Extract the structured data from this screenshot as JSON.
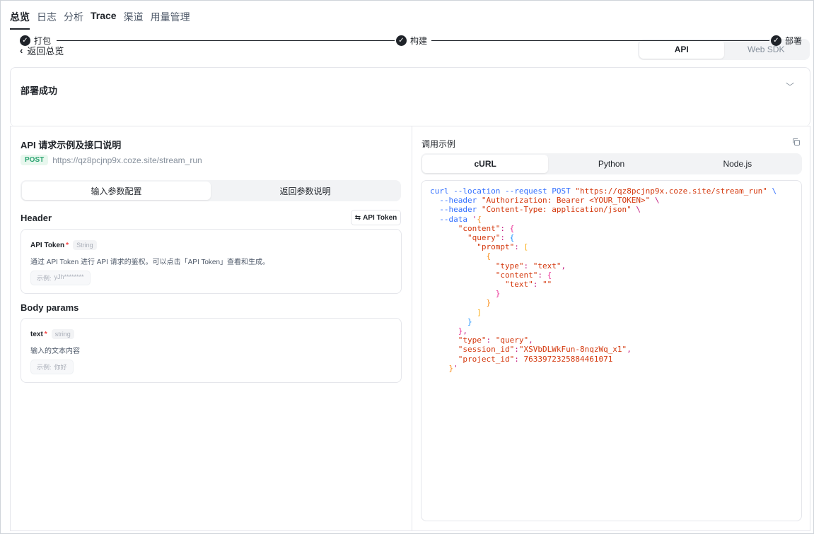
{
  "nav": {
    "tabs": [
      {
        "label": "总览"
      },
      {
        "label": "日志"
      },
      {
        "label": "分析"
      },
      {
        "label": "Trace"
      },
      {
        "label": "渠道"
      },
      {
        "label": "用量管理"
      }
    ]
  },
  "back_label": "返回总览",
  "mode_switch": {
    "api": "API",
    "web_sdk": "Web SDK"
  },
  "deploy": {
    "title": "部署成功",
    "steps": [
      {
        "label": "打包"
      },
      {
        "label": "构建"
      },
      {
        "label": "部署"
      }
    ]
  },
  "api": {
    "title": "API 请求示例及接口说明",
    "method": "POST",
    "url": "https://qz8pcjnp9x.coze.site/stream_run",
    "tabs": {
      "input": "输入参数配置",
      "output": "返回参数说明"
    },
    "header_section": "Header",
    "token_button": "API Token",
    "header_params": [
      {
        "name": "API Token",
        "type": "String",
        "desc": "通过 API Token 进行 API 请求的鉴权。可以点击「API Token」查看和生成。",
        "example_label": "示例:",
        "example": "yJh********"
      }
    ],
    "body_section": "Body params",
    "body_params": [
      {
        "name": "text",
        "type": "string",
        "desc": "输入的文本内容",
        "example_label": "示例:",
        "example": "你好"
      }
    ]
  },
  "call": {
    "title": "调用示例",
    "langs": {
      "curl": "cURL",
      "python": "Python",
      "node": "Node.js"
    }
  },
  "code_lines": [
    "curl --location --request POST \"https://qz8pcjnp9x.coze.site/stream_run\" \\",
    "  --header \"Authorization: Bearer <YOUR_TOKEN>\" \\",
    "  --header \"Content-Type: application/json\" \\",
    "  --data '{",
    "      \"content\": {",
    "        \"query\": {",
    "          \"prompt\": [",
    "            {",
    "              \"type\": \"text\",",
    "              \"content\": {",
    "                \"text\": \"\"",
    "              }",
    "            }",
    "          ]",
    "        }",
    "      },",
    "      \"type\": \"query\",",
    "      \"session_id\":\"XSVbDLWkFun-8nqzWq_x1\",",
    "      \"project_id\": 7633972325884461071",
    "    }'"
  ],
  "colors": {
    "accent": "#1f2329",
    "post_badge": "#2ba471",
    "code_text": "#c41d7f"
  }
}
